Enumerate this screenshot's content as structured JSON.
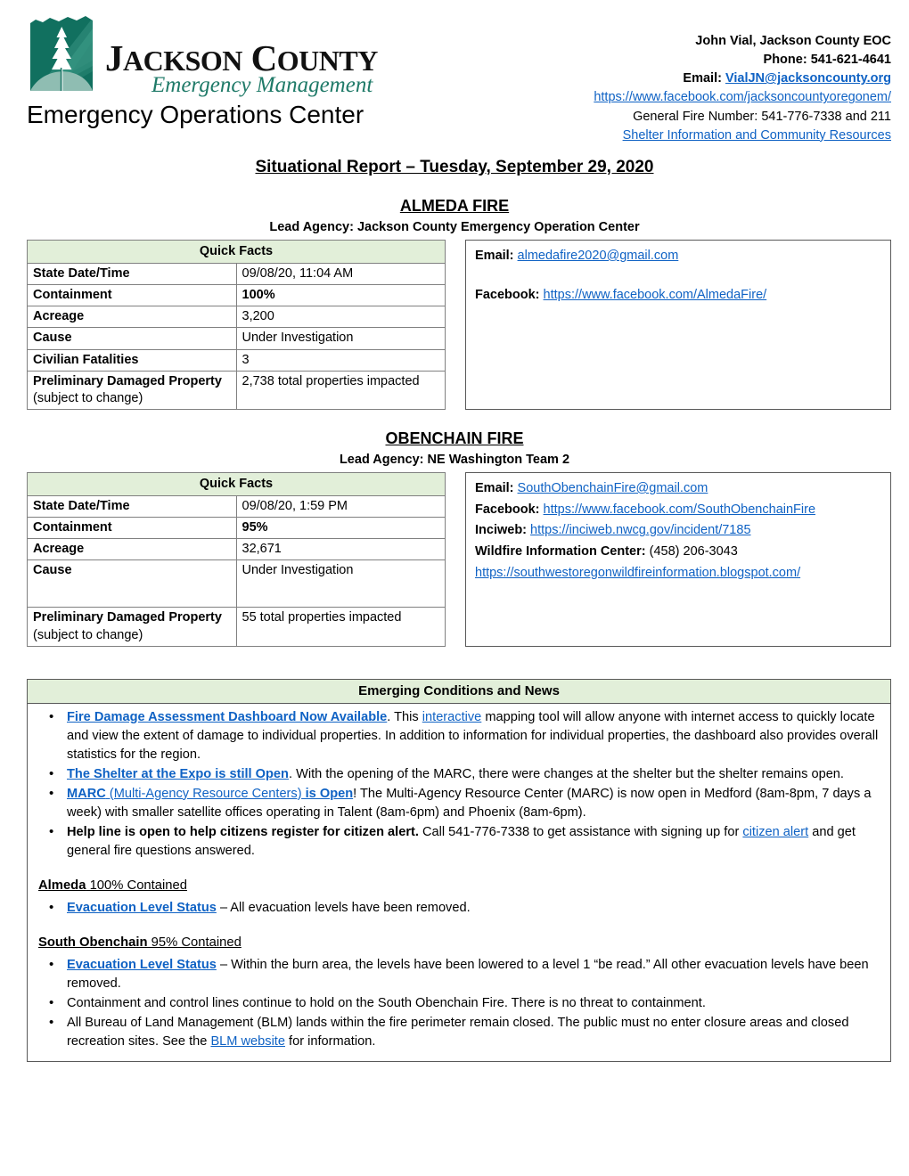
{
  "header": {
    "logo": {
      "org_line1_j": "J",
      "org_line1_rest": "ACKSON",
      "org_line1_c": "C",
      "org_line1_rest2": "OUNTY",
      "org_line2": "Emergency Management",
      "org_line3": "Emergency Operations Center",
      "logo_colors": {
        "dark_teal": "#11705f",
        "mid_teal": "#2d8a78",
        "light_teal": "#7fb3a8"
      }
    },
    "contact": {
      "name_label": "John Vial, Jackson County EOC",
      "phone_label": "Phone: 541-621-4641",
      "email_label": "Email: ",
      "email_value": "VialJN@jacksoncounty.org",
      "facebook_url": "https://www.facebook.com/jacksoncountyoregonem/",
      "general_fire": "General Fire Number: 541-776-7338 and 211",
      "shelter_link": "Shelter Information and Community Resources"
    }
  },
  "doc_title": "Situational Report – Tuesday, September 29, 2020",
  "fires": [
    {
      "title": "ALMEDA FIRE",
      "lead_agency": "Lead Agency: Jackson County Emergency Operation Center",
      "quick_facts_header": "Quick Facts",
      "rows": [
        {
          "key": "State Date/Time",
          "key_note": "",
          "value": "09/08/20, 11:04 AM",
          "bold_value": false
        },
        {
          "key": "Containment",
          "key_note": "",
          "value": "100%",
          "bold_value": true
        },
        {
          "key": "Acreage",
          "key_note": "",
          "value": "3,200",
          "bold_value": false
        },
        {
          "key": "Cause",
          "key_note": "",
          "value": "Under Investigation",
          "bold_value": false
        },
        {
          "key": "Civilian Fatalities",
          "key_note": "",
          "value": "3",
          "bold_value": false
        },
        {
          "key": "Preliminary Damaged Property",
          "key_note": " (subject to change)",
          "value": "2,738 total properties impacted",
          "bold_value": false
        }
      ],
      "contact_lines": [
        {
          "label": "Email: ",
          "link": "almedafire2020@gmail.com",
          "gap": false
        },
        {
          "label": "Facebook: ",
          "link": "https://www.facebook.com/AlmedaFire/",
          "gap": true
        }
      ]
    },
    {
      "title": "OBENCHAIN FIRE",
      "lead_agency": "Lead Agency: NE Washington Team 2",
      "quick_facts_header": "Quick Facts",
      "rows": [
        {
          "key": "State Date/Time",
          "key_note": "",
          "value": "09/08/20, 1:59 PM",
          "bold_value": false
        },
        {
          "key": "Containment",
          "key_note": "",
          "value": "95%",
          "bold_value": true
        },
        {
          "key": "Acreage",
          "key_note": "",
          "value": "32,671",
          "bold_value": false
        },
        {
          "key": "Cause",
          "key_note": "",
          "value": "Under Investigation",
          "bold_value": false
        },
        {
          "key": "Preliminary Damaged Property",
          "key_note": " (subject to change)",
          "value": "55 total properties impacted",
          "bold_value": false
        }
      ],
      "contact_lines": [
        {
          "label": "Email: ",
          "link": "SouthObenchainFire@gmail.com",
          "gap": false
        },
        {
          "label": "Facebook: ",
          "link": "https://www.facebook.com/SouthObenchainFire",
          "gap": false
        },
        {
          "label": "Inciweb: ",
          "link": "https://inciweb.nwcg.gov/incident/7185",
          "gap": false
        },
        {
          "label": "Wildfire Information Center: ",
          "plain": "(458) 206-3043",
          "gap": false
        },
        {
          "label": "",
          "link": "https://southwestoregonwildfireinformation.blogspot.com/",
          "gap": false
        }
      ]
    }
  ],
  "news": {
    "header": "Emerging Conditions and News",
    "bullets": [
      {
        "segments": [
          {
            "text": "Fire Damage Assessment Dashboard Now Available",
            "style": "link-bold"
          },
          {
            "text": ". This ",
            "style": "plain"
          },
          {
            "text": "interactive",
            "style": "link"
          },
          {
            "text": " mapping tool will allow anyone with internet access to quickly locate and view the extent of damage to individual properties. In addition to information for individual properties, the dashboard also provides overall statistics for the region.",
            "style": "plain"
          }
        ]
      },
      {
        "segments": [
          {
            "text": "The Shelter at the Expo is still Open",
            "style": "link-bold"
          },
          {
            "text": ". With the opening of the MARC, there were changes at the shelter but the shelter remains open.",
            "style": "plain"
          }
        ]
      },
      {
        "segments": [
          {
            "text": "MARC",
            "style": "link-bold"
          },
          {
            "text": " (Multi-Agency Resource Centers)",
            "style": "link"
          },
          {
            "text": " is Open",
            "style": "link-bold"
          },
          {
            "text": "! The Multi-Agency Resource Center (MARC) is now open in Medford (8am-8pm, 7 days a week) with smaller satellite offices operating in Talent (8am-6pm) and Phoenix (8am-6pm).",
            "style": "plain"
          }
        ]
      },
      {
        "segments": [
          {
            "text": "Help line is open to help citizens register for citizen alert.",
            "style": "bold"
          },
          {
            "text": " Call 541-776-7338 to get assistance with signing up for ",
            "style": "plain"
          },
          {
            "text": "citizen alert",
            "style": "link"
          },
          {
            "text": " and get general fire questions answered.",
            "style": "plain"
          }
        ]
      }
    ],
    "sections": [
      {
        "heading_name": "Almeda",
        "heading_rest": " 100% Contained",
        "bullets": [
          {
            "segments": [
              {
                "text": "Evacuation Level Status",
                "style": "link-bold"
              },
              {
                "text": " – All evacuation levels have been removed.",
                "style": "plain"
              }
            ]
          }
        ]
      },
      {
        "heading_name": "South Obenchain",
        "heading_rest": " 95% Contained",
        "bullets": [
          {
            "segments": [
              {
                "text": "Evacuation Level Status",
                "style": "link-bold"
              },
              {
                "text": " – Within the burn area, the levels have been lowered to a level 1 “be read.” All other evacuation levels have been removed.",
                "style": "plain"
              }
            ]
          },
          {
            "segments": [
              {
                "text": "Containment and control lines continue to hold on the South Obenchain Fire. There is no threat to containment.",
                "style": "plain"
              }
            ]
          },
          {
            "segments": [
              {
                "text": "All Bureau of Land Management (BLM) lands within the fire perimeter remain closed. The public must no enter closure areas and closed recreation sites. See the ",
                "style": "plain"
              },
              {
                "text": "BLM website",
                "style": "link"
              },
              {
                "text": " for information.",
                "style": "plain"
              }
            ]
          }
        ]
      }
    ]
  },
  "colors": {
    "table_header_green": "#e2efd9",
    "link_blue": "#0f62c4",
    "logo_teal": "#11705f",
    "border_gray": "#595959"
  }
}
